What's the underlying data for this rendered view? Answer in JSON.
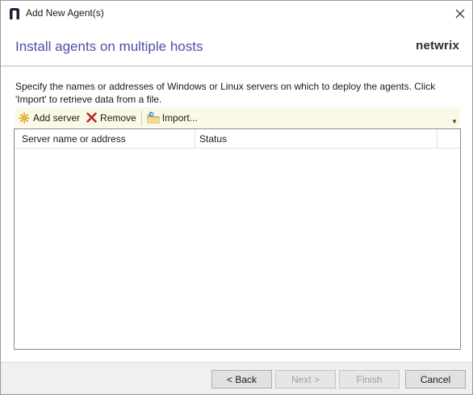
{
  "window": {
    "title": "Add New Agent(s)",
    "close_icon": "close-icon"
  },
  "header": {
    "title": "Install agents on multiple hosts",
    "logo_text": "netwrix",
    "title_color": "#4b4fa8"
  },
  "description": "Specify the names or addresses of Windows or Linux servers on which to deploy the agents. Click 'Import' to retrieve data from a file.",
  "toolbar": {
    "add_label": "Add server",
    "remove_label": "Remove",
    "import_label": "Import...",
    "background": "#fbf8e6"
  },
  "grid": {
    "columns": [
      "Server name or address",
      "Status"
    ],
    "rows": []
  },
  "footer": {
    "back_label": "< Back",
    "next_label": "Next >",
    "finish_label": "Finish",
    "cancel_label": "Cancel"
  }
}
